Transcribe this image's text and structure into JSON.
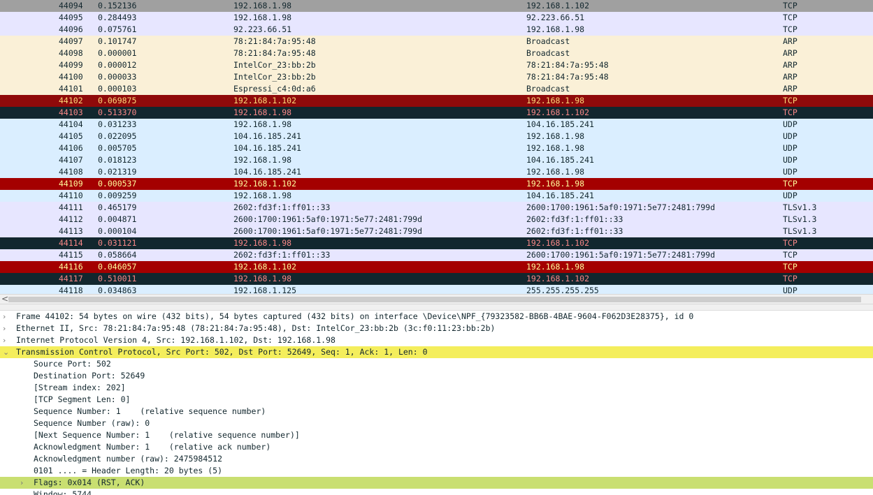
{
  "packet_list": {
    "rows": [
      {
        "no": "44094",
        "time": "0.152136",
        "source": "192.168.1.98",
        "destination": "192.168.1.102",
        "protocol": "TCP",
        "bg": "#a0a0a0",
        "fg": "#12272e"
      },
      {
        "no": "44095",
        "time": "0.284493",
        "source": "192.168.1.98",
        "destination": "92.223.66.51",
        "protocol": "TCP",
        "bg": "#e7e6ff",
        "fg": "#12272e"
      },
      {
        "no": "44096",
        "time": "0.075761",
        "source": "92.223.66.51",
        "destination": "192.168.1.98",
        "protocol": "TCP",
        "bg": "#e7e6ff",
        "fg": "#12272e"
      },
      {
        "no": "44097",
        "time": "0.101747",
        "source": "78:21:84:7a:95:48",
        "destination": "Broadcast",
        "protocol": "ARP",
        "bg": "#faf0d7",
        "fg": "#12272e"
      },
      {
        "no": "44098",
        "time": "0.000001",
        "source": "78:21:84:7a:95:48",
        "destination": "Broadcast",
        "protocol": "ARP",
        "bg": "#faf0d7",
        "fg": "#12272e"
      },
      {
        "no": "44099",
        "time": "0.000012",
        "source": "IntelCor_23:bb:2b",
        "destination": "78:21:84:7a:95:48",
        "protocol": "ARP",
        "bg": "#faf0d7",
        "fg": "#12272e"
      },
      {
        "no": "44100",
        "time": "0.000033",
        "source": "IntelCor_23:bb:2b",
        "destination": "78:21:84:7a:95:48",
        "protocol": "ARP",
        "bg": "#faf0d7",
        "fg": "#12272e"
      },
      {
        "no": "44101",
        "time": "0.000103",
        "source": "Espressi_c4:0d:a6",
        "destination": "Broadcast",
        "protocol": "ARP",
        "bg": "#faf0d7",
        "fg": "#12272e"
      },
      {
        "no": "44102",
        "time": "0.069875",
        "source": "192.168.1.102",
        "destination": "192.168.1.98",
        "protocol": "TCP",
        "bg": "#8f0a0a",
        "fg": "#ffd978"
      },
      {
        "no": "44103",
        "time": "0.513370",
        "source": "192.168.1.98",
        "destination": "192.168.1.102",
        "protocol": "TCP",
        "bg": "#12272e",
        "fg": "#f78787"
      },
      {
        "no": "44104",
        "time": "0.031233",
        "source": "192.168.1.98",
        "destination": "104.16.185.241",
        "protocol": "UDP",
        "bg": "#daeeff",
        "fg": "#12272e"
      },
      {
        "no": "44105",
        "time": "0.022095",
        "source": "104.16.185.241",
        "destination": "192.168.1.98",
        "protocol": "UDP",
        "bg": "#daeeff",
        "fg": "#12272e"
      },
      {
        "no": "44106",
        "time": "0.005705",
        "source": "104.16.185.241",
        "destination": "192.168.1.98",
        "protocol": "UDP",
        "bg": "#daeeff",
        "fg": "#12272e"
      },
      {
        "no": "44107",
        "time": "0.018123",
        "source": "192.168.1.98",
        "destination": "104.16.185.241",
        "protocol": "UDP",
        "bg": "#daeeff",
        "fg": "#12272e"
      },
      {
        "no": "44108",
        "time": "0.021319",
        "source": "104.16.185.241",
        "destination": "192.168.1.98",
        "protocol": "UDP",
        "bg": "#daeeff",
        "fg": "#12272e"
      },
      {
        "no": "44109",
        "time": "0.000537",
        "source": "192.168.1.102",
        "destination": "192.168.1.98",
        "protocol": "TCP",
        "bg": "#a40000",
        "fg": "#fffc9c"
      },
      {
        "no": "44110",
        "time": "0.009259",
        "source": "192.168.1.98",
        "destination": "104.16.185.241",
        "protocol": "UDP",
        "bg": "#daeeff",
        "fg": "#12272e"
      },
      {
        "no": "44111",
        "time": "0.465179",
        "source": "2602:fd3f:1:ff01::33",
        "destination": "2600:1700:1961:5af0:1971:5e77:2481:799d",
        "protocol": "TLSv1.3",
        "bg": "#e7e6ff",
        "fg": "#12272e"
      },
      {
        "no": "44112",
        "time": "0.004871",
        "source": "2600:1700:1961:5af0:1971:5e77:2481:799d",
        "destination": "2602:fd3f:1:ff01::33",
        "protocol": "TLSv1.3",
        "bg": "#e7e6ff",
        "fg": "#12272e"
      },
      {
        "no": "44113",
        "time": "0.000104",
        "source": "2600:1700:1961:5af0:1971:5e77:2481:799d",
        "destination": "2602:fd3f:1:ff01::33",
        "protocol": "TLSv1.3",
        "bg": "#e7e6ff",
        "fg": "#12272e"
      },
      {
        "no": "44114",
        "time": "0.031121",
        "source": "192.168.1.98",
        "destination": "192.168.1.102",
        "protocol": "TCP",
        "bg": "#12272e",
        "fg": "#f78787"
      },
      {
        "no": "44115",
        "time": "0.058664",
        "source": "2602:fd3f:1:ff01::33",
        "destination": "2600:1700:1961:5af0:1971:5e77:2481:799d",
        "protocol": "TCP",
        "bg": "#e7e6ff",
        "fg": "#12272e"
      },
      {
        "no": "44116",
        "time": "0.046057",
        "source": "192.168.1.102",
        "destination": "192.168.1.98",
        "protocol": "TCP",
        "bg": "#a40000",
        "fg": "#fffc9c"
      },
      {
        "no": "44117",
        "time": "0.510011",
        "source": "192.168.1.98",
        "destination": "192.168.1.102",
        "protocol": "TCP",
        "bg": "#12272e",
        "fg": "#f78787"
      },
      {
        "no": "44118",
        "time": "0.034863",
        "source": "192.168.1.125",
        "destination": "255.255.255.255",
        "protocol": "UDP",
        "bg": "#daeeff",
        "fg": "#12272e"
      }
    ]
  },
  "scrollbar": {
    "left_arrow": "<"
  },
  "details": {
    "rows": [
      {
        "level": 0,
        "expander": ">",
        "text": "Frame 44102: 54 bytes on wire (432 bits), 54 bytes captured (432 bits) on interface \\Device\\NPF_{79323582-BB6B-4BAE-9604-F062D3E28375}, id 0",
        "highlight": ""
      },
      {
        "level": 0,
        "expander": ">",
        "text": "Ethernet II, Src: 78:21:84:7a:95:48 (78:21:84:7a:95:48), Dst: IntelCor_23:bb:2b (3c:f0:11:23:bb:2b)",
        "highlight": ""
      },
      {
        "level": 0,
        "expander": ">",
        "text": "Internet Protocol Version 4, Src: 192.168.1.102, Dst: 192.168.1.98",
        "highlight": ""
      },
      {
        "level": 0,
        "expander": "v",
        "text": "Transmission Control Protocol, Src Port: 502, Dst Port: 52649, Seq: 1, Ack: 1, Len: 0",
        "highlight": "yellow"
      },
      {
        "level": 1,
        "expander": "",
        "text": "Source Port: 502",
        "highlight": ""
      },
      {
        "level": 1,
        "expander": "",
        "text": "Destination Port: 52649",
        "highlight": ""
      },
      {
        "level": 1,
        "expander": "",
        "text": "[Stream index: 202]",
        "highlight": ""
      },
      {
        "level": 1,
        "expander": "",
        "text": "[TCP Segment Len: 0]",
        "highlight": ""
      },
      {
        "level": 1,
        "expander": "",
        "text": "Sequence Number: 1    (relative sequence number)",
        "highlight": ""
      },
      {
        "level": 1,
        "expander": "",
        "text": "Sequence Number (raw): 0",
        "highlight": ""
      },
      {
        "level": 1,
        "expander": "",
        "text": "[Next Sequence Number: 1    (relative sequence number)]",
        "highlight": ""
      },
      {
        "level": 1,
        "expander": "",
        "text": "Acknowledgment Number: 1    (relative ack number)",
        "highlight": ""
      },
      {
        "level": 1,
        "expander": "",
        "text": "Acknowledgment number (raw): 2475984512",
        "highlight": ""
      },
      {
        "level": 1,
        "expander": "",
        "text": "0101 .... = Header Length: 20 bytes (5)",
        "highlight": ""
      },
      {
        "level": 1,
        "expander": ">",
        "text": "Flags: 0x014 (RST, ACK)",
        "highlight": "green"
      },
      {
        "level": 1,
        "expander": "",
        "text": "Window: 5744",
        "highlight": ""
      }
    ]
  }
}
